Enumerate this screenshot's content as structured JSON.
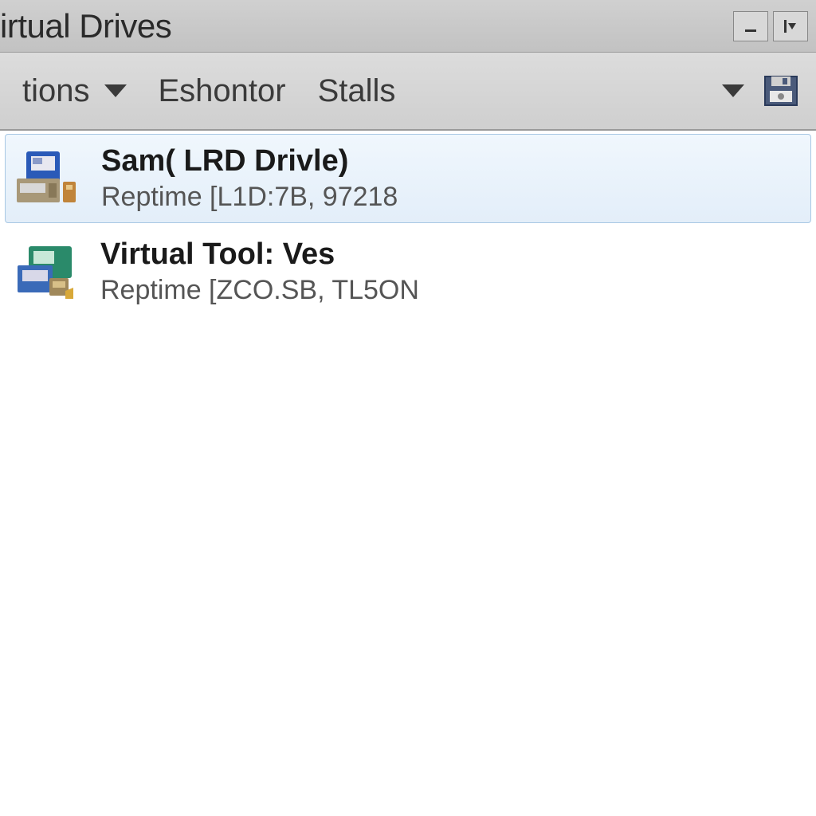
{
  "window": {
    "title": "irtual Drives"
  },
  "toolbar": {
    "items": [
      {
        "label": "tions",
        "hasDropdown": true
      },
      {
        "label": "Eshontor",
        "hasDropdown": false
      },
      {
        "label": "Stalls",
        "hasDropdown": false
      }
    ]
  },
  "drives": [
    {
      "title": "Sam( LRD Drivle)",
      "subtitle": "Reptime [L1D:7B, 97218",
      "selected": true
    },
    {
      "title": "Virtual Tool: Ves",
      "subtitle": "Reptime [ZCO.ЅB, TL5ON",
      "selected": false
    }
  ]
}
